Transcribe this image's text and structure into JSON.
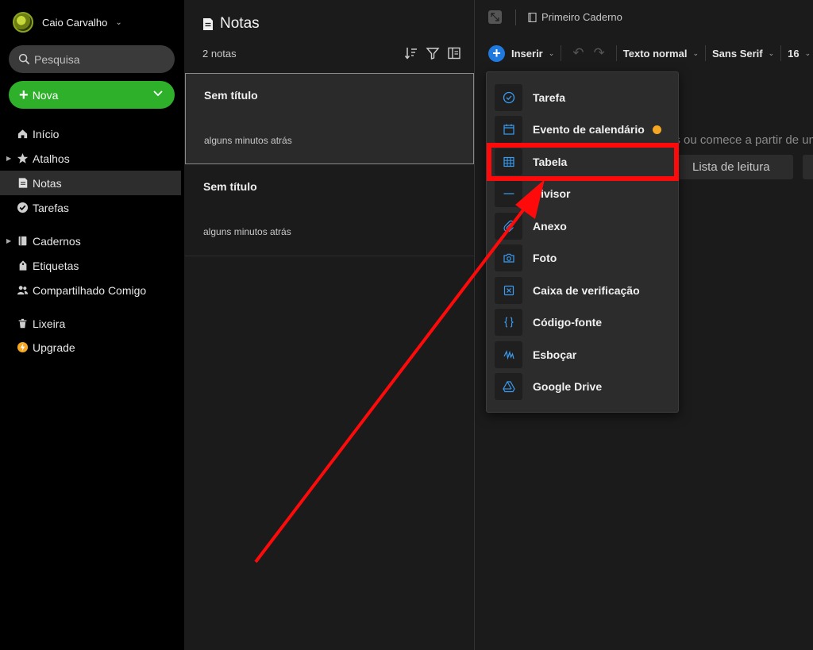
{
  "user": {
    "name": "Caio Carvalho"
  },
  "search": {
    "placeholder": "Pesquisa"
  },
  "new_button": {
    "label": "Nova"
  },
  "sidebar": {
    "items": [
      {
        "label": "Início",
        "icon": "home-icon"
      },
      {
        "label": "Atalhos",
        "icon": "star-icon"
      },
      {
        "label": "Notas",
        "icon": "note-icon",
        "active": true
      },
      {
        "label": "Tarefas",
        "icon": "check-circle-icon"
      },
      {
        "label": "Cadernos",
        "icon": "notebook-icon"
      },
      {
        "label": "Etiquetas",
        "icon": "tag-icon"
      },
      {
        "label": "Compartilhado Comigo",
        "icon": "people-icon"
      },
      {
        "label": "Lixeira",
        "icon": "trash-icon"
      },
      {
        "label": "Upgrade",
        "icon": "bolt-icon"
      }
    ]
  },
  "notes_list": {
    "title": "Notas",
    "count": "2 notas",
    "notes": [
      {
        "title": "Sem título",
        "time": "alguns minutos atrás"
      },
      {
        "title": "Sem título",
        "time": "alguns minutos atrás"
      }
    ]
  },
  "editor": {
    "notebook": "Primeiro Caderno",
    "toolbar": {
      "insert": "Inserir",
      "style": "Texto normal",
      "font": "Sans Serif",
      "size": "16"
    },
    "hint_text": "os ou comece a partir de um",
    "template_chip": "Lista de leitura"
  },
  "insert_menu": {
    "items": [
      {
        "label": "Tarefa",
        "icon": "task-check-icon"
      },
      {
        "label": "Evento de calendário",
        "icon": "calendar-icon",
        "badge": true
      },
      {
        "label": "Tabela",
        "icon": "table-icon"
      },
      {
        "label": "Divisor",
        "icon": "divider-icon"
      },
      {
        "label": "Anexo",
        "icon": "paperclip-icon"
      },
      {
        "label": "Foto",
        "icon": "camera-icon"
      },
      {
        "label": "Caixa de verificação",
        "icon": "checkbox-icon"
      },
      {
        "label": "Código-fonte",
        "icon": "code-braces-icon"
      },
      {
        "label": "Esboçar",
        "icon": "sketch-icon"
      },
      {
        "label": "Google Drive",
        "icon": "google-drive-icon"
      }
    ]
  },
  "colors": {
    "accent_green": "#2fb02a",
    "accent_blue": "#1f7ae0",
    "annotation_red": "#ff0a0a",
    "premium_badge": "#f5a623"
  }
}
